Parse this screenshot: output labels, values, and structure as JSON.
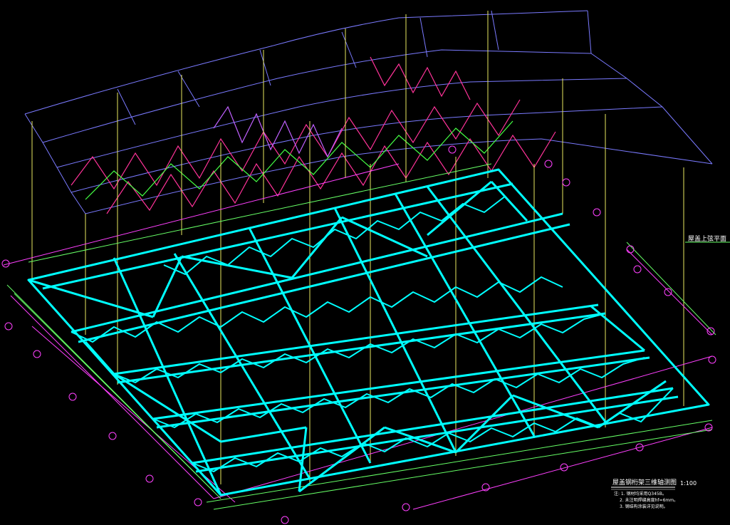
{
  "drawing": {
    "side_label": "屋盖上弦平面",
    "title": "屋盖钢桁架三维轴测图",
    "scale": "1:100",
    "notes": [
      "注: 1. 钢材均采用Q345B。",
      "2. 未注明焊缝高度hf=6mm。",
      "3. 钢结构涂装详见说明。"
    ]
  },
  "colors": {
    "background": "#000000",
    "truss_cyan": "#00ffff",
    "upper_truss_magenta": "#ff3399",
    "upper_truss_green": "#44ff44",
    "upper_frame_blue": "#8080ff",
    "columns_yellow": "#e8e860",
    "grid_magenta": "#ff40ff",
    "dimension_green": "#66ff66",
    "text_white": "#ffffff"
  }
}
